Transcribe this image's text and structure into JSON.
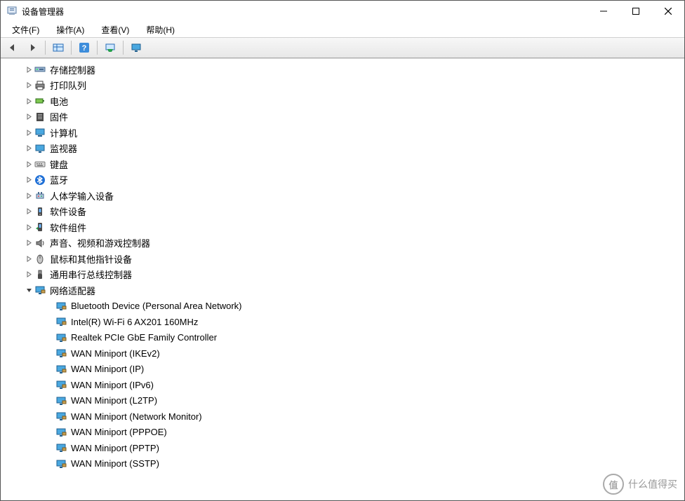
{
  "window": {
    "title": "设备管理器"
  },
  "menu": {
    "file": "文件(F)",
    "action": "操作(A)",
    "view": "查看(V)",
    "help": "帮助(H)"
  },
  "toolbar_icons": {
    "back": "back-arrow-icon",
    "forward": "forward-arrow-icon",
    "show_hidden": "show-hidden-icon",
    "help": "help-icon",
    "scan": "scan-hardware-icon",
    "monitor": "monitor-icon"
  },
  "categories": [
    {
      "icon": "storage-controller-icon",
      "label": "存储控制器",
      "expanded": false
    },
    {
      "icon": "printer-icon",
      "label": "打印队列",
      "expanded": false
    },
    {
      "icon": "battery-icon",
      "label": "电池",
      "expanded": false
    },
    {
      "icon": "firmware-icon",
      "label": "固件",
      "expanded": false
    },
    {
      "icon": "computer-icon",
      "label": "计算机",
      "expanded": false
    },
    {
      "icon": "monitor-device-icon",
      "label": "监视器",
      "expanded": false
    },
    {
      "icon": "keyboard-icon",
      "label": "键盘",
      "expanded": false
    },
    {
      "icon": "bluetooth-icon",
      "label": "蓝牙",
      "expanded": false
    },
    {
      "icon": "hid-icon",
      "label": "人体学输入设备",
      "expanded": false
    },
    {
      "icon": "software-device-icon",
      "label": "软件设备",
      "expanded": false
    },
    {
      "icon": "software-component-icon",
      "label": "软件组件",
      "expanded": false
    },
    {
      "icon": "sound-icon",
      "label": "声音、视频和游戏控制器",
      "expanded": false
    },
    {
      "icon": "mouse-icon",
      "label": "鼠标和其他指针设备",
      "expanded": false
    },
    {
      "icon": "usb-icon",
      "label": "通用串行总线控制器",
      "expanded": false
    },
    {
      "icon": "network-adapter-icon",
      "label": "网络适配器",
      "expanded": true,
      "children": [
        {
          "icon": "network-adapter-icon",
          "label": "Bluetooth Device (Personal Area Network)"
        },
        {
          "icon": "network-adapter-icon",
          "label": "Intel(R) Wi-Fi 6 AX201 160MHz"
        },
        {
          "icon": "network-adapter-icon",
          "label": "Realtek PCIe GbE Family Controller"
        },
        {
          "icon": "network-adapter-icon",
          "label": "WAN Miniport (IKEv2)"
        },
        {
          "icon": "network-adapter-icon",
          "label": "WAN Miniport (IP)"
        },
        {
          "icon": "network-adapter-icon",
          "label": "WAN Miniport (IPv6)"
        },
        {
          "icon": "network-adapter-icon",
          "label": "WAN Miniport (L2TP)"
        },
        {
          "icon": "network-adapter-icon",
          "label": "WAN Miniport (Network Monitor)"
        },
        {
          "icon": "network-adapter-icon",
          "label": "WAN Miniport (PPPOE)"
        },
        {
          "icon": "network-adapter-icon",
          "label": "WAN Miniport (PPTP)"
        },
        {
          "icon": "network-adapter-icon",
          "label": "WAN Miniport (SSTP)"
        }
      ]
    }
  ],
  "watermark": {
    "badge": "值",
    "text": "什么值得买"
  }
}
